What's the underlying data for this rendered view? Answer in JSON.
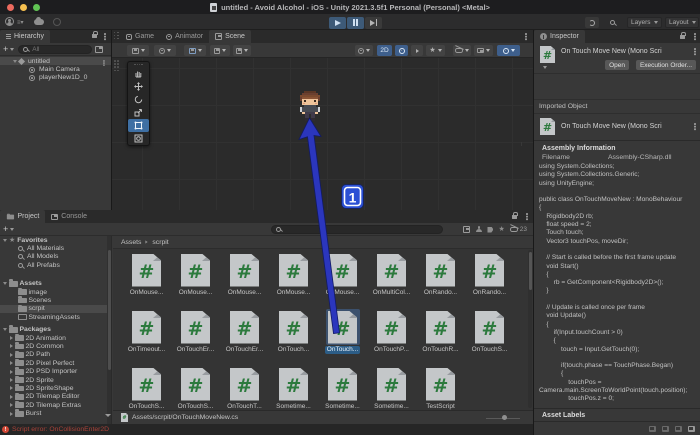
{
  "title_bar": {
    "title": "untitled - Avoid Alcohol - iOS - Unity 2021.3.5f1 Personal (Personal) <Metal>"
  },
  "toolbar": {
    "layers": "Layers",
    "layout": "Layout"
  },
  "hierarchy": {
    "tab": "Hierarchy",
    "search_placeholder": "All",
    "scene_name": "untitled",
    "children": [
      "Main Camera",
      "playerNew1D_0"
    ]
  },
  "scene_view": {
    "tabs": [
      "Game",
      "Animator",
      "Scene"
    ],
    "btn_2d": "2D"
  },
  "annotation": {
    "step_label": "1"
  },
  "inspector": {
    "tab": "Inspector",
    "title": "On Touch Move New (Mono Scri",
    "open_btn": "Open",
    "exec_order_btn": "Execution Order...",
    "imported_object": "Imported Object",
    "imported_title": "On Touch Move New (Mono Scri",
    "assembly_information": "Assembly Information",
    "filename_label": "Filename",
    "filename_value": "Assembly-CSharp.dll",
    "asset_labels": "Asset Labels",
    "code": [
      "using System.Collections;",
      "using System.Collections.Generic;",
      "using UnityEngine;",
      "",
      "public class OnTouchMoveNew : MonoBehaviour",
      "{",
      "    Rigidbody2D rb;",
      "    float speed = 2;",
      "    Touch touch;",
      "    Vector3 touchPos, moveDir;",
      "",
      "    // Start is called before the first frame update",
      "    void Start()",
      "    {",
      "        rb = GetComponent<Rigidbody2D>();",
      "    }",
      "",
      "    // Update is called once per frame",
      "    void Update()",
      "    {",
      "        if(Input.touchCount > 0)",
      "        {",
      "            touch = Input.GetTouch(0);",
      "",
      "            if(touch.phase == TouchPhase.Began)",
      "            {",
      "                touchPos =",
      "Camera.main.ScreenToWorldPoint(touch.position);",
      "                touchPos.z = 0;"
    ]
  },
  "project": {
    "tabs": [
      "Project",
      "Console"
    ],
    "favorites_label": "Favorites",
    "favorites": [
      "All Materials",
      "All Models",
      "All Prefabs"
    ],
    "assets_label": "Assets",
    "assets": [
      "image",
      "Scenes",
      "scrpit",
      "StreamingAssets"
    ],
    "packages_label": "Packages",
    "packages": [
      "2D Animation",
      "2D Common",
      "2D Path",
      "2D Pixel Perfect",
      "2D PSD Importer",
      "2D Sprite",
      "2D SpriteShape",
      "2D Tilemap Editor",
      "2D Tilemap Extras",
      "Burst"
    ],
    "breadcrumb_root": "Assets",
    "breadcrumb_folder": "scrpit",
    "hidden_count": "23",
    "grid_items": [
      "OnMouse...",
      "OnMouse...",
      "OnMouse...",
      "OnMouse...",
      "OnMouse...",
      "OnMultiCol...",
      "OnRando...",
      "OnRando...",
      "OnTimeout...",
      "OnTouchEr...",
      "OnTouchEr...",
      "OnTouch...",
      "OnTouch...",
      "OnTouchP...",
      "OnTouchR...",
      "OnTouchS...",
      "OnTouchS...",
      "OnTouchS...",
      "OnTouchT...",
      "Sometime...",
      "Sometime...",
      "Sometime...",
      "TestScript"
    ],
    "footer_path": "Assets/scrpit/OnTouchMoveNew.cs"
  },
  "status_bar": {
    "error": "Script error: OnCollisionEnter2D"
  }
}
